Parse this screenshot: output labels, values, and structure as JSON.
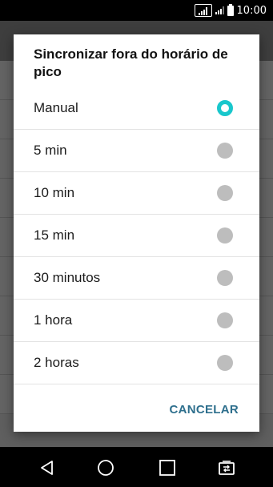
{
  "status_bar": {
    "sim1_label": "3G",
    "sim2_label": "2G",
    "time": "10:00"
  },
  "dialog": {
    "title": "Sincronizar fora do horário de pico",
    "options": [
      {
        "label": "Manual",
        "selected": true
      },
      {
        "label": "5 min",
        "selected": false
      },
      {
        "label": "10 min",
        "selected": false
      },
      {
        "label": "15 min",
        "selected": false
      },
      {
        "label": "30 minutos",
        "selected": false
      },
      {
        "label": "1 hora",
        "selected": false
      },
      {
        "label": "2 horas",
        "selected": false
      }
    ],
    "cancel_label": "CANCELAR"
  },
  "colors": {
    "accent": "#19c7cc",
    "cancel_text": "#2e6f8d",
    "radio_unselected": "#bdbdbd"
  },
  "navigation": {
    "icons": [
      "back-icon",
      "home-icon",
      "recents-icon",
      "dual-window-icon"
    ]
  }
}
